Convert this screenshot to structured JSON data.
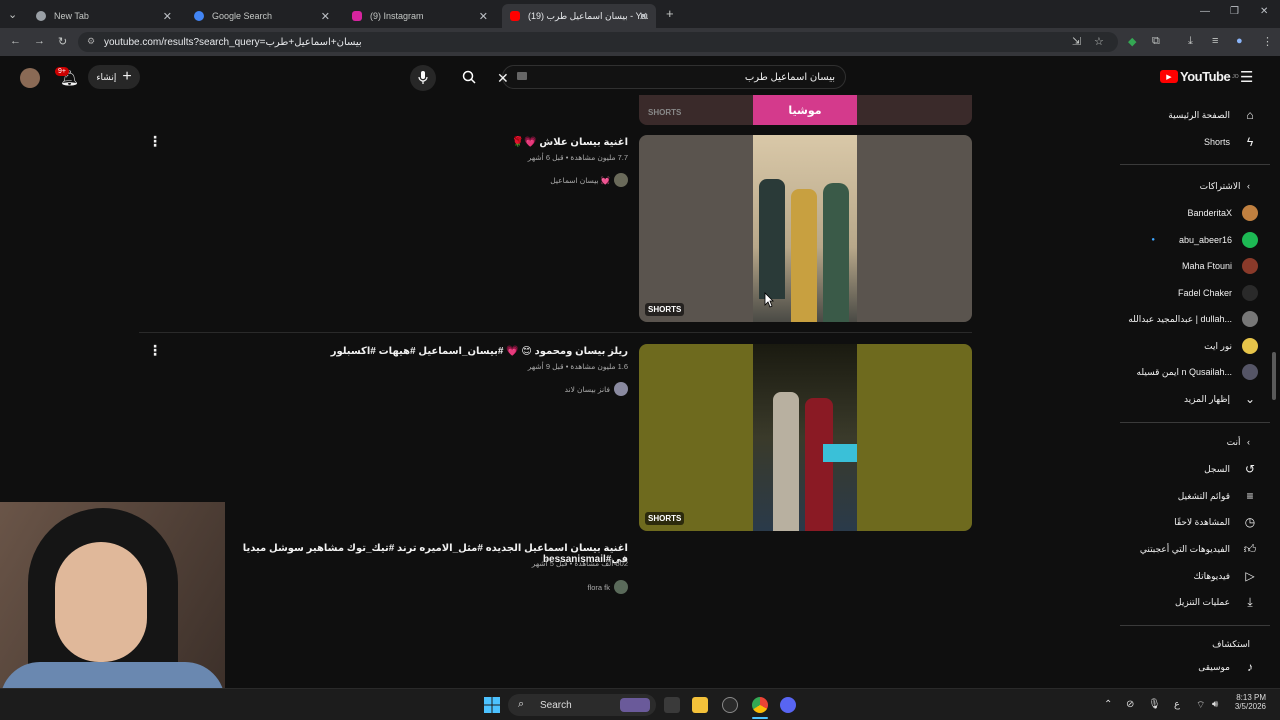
{
  "browser": {
    "tabs": [
      {
        "title": "New Tab",
        "active": false
      },
      {
        "title": "Google Search",
        "active": false
      },
      {
        "title": "(9) Instagram",
        "active": false
      },
      {
        "title": "(19) بيسان اسماعيل طرب - YouTube",
        "active": true
      }
    ],
    "url": "youtube.com/results?search_query=بيسان+اسماعيل+طرب"
  },
  "youtube": {
    "logo": "YouTube",
    "logo_country": "JO",
    "search_query": "بيسان اسماعيل طرب",
    "create_label": "إنشاء",
    "notif_count": "9+",
    "sidebar": {
      "home": "الصفحة الرئيسية",
      "shorts": "Shorts",
      "subscriptions_header": "الاشتراكات",
      "subscriptions": [
        {
          "name": "BanderitaX",
          "color": "#c08040"
        },
        {
          "name": "abu_abeer16",
          "color": "#1db954"
        },
        {
          "name": "Maha Ftouni",
          "color": "#8a3a2a"
        },
        {
          "name": "Fadel Chaker",
          "color": "#2a2a2a"
        },
        {
          "name": "عبدالمجيد عبدالله | dullah...",
          "color": "#777"
        },
        {
          "name": "نور ايت",
          "color": "#e6c44a"
        },
        {
          "name": "ايمن قسيله n Qusailah...",
          "color": "#556"
        }
      ],
      "show_more": "إظهار المزيد",
      "you_header": "أنت",
      "you_items": [
        {
          "label": "السجل",
          "icon": "history-icon"
        },
        {
          "label": "قوائم التشغيل",
          "icon": "playlist-icon"
        },
        {
          "label": "المشاهدة لاحقًا",
          "icon": "watch-later-icon"
        },
        {
          "label": "الفيديوهات التي أعجبتني",
          "icon": "like-icon"
        },
        {
          "label": "فيديوهاتك",
          "icon": "your-videos-icon"
        },
        {
          "label": "عمليات التنزيل",
          "icon": "download-icon"
        }
      ],
      "explore_header": "استكشاف",
      "music": "موسيقى"
    },
    "results": [
      {
        "title": "اغنية بيسان علاش 💗🌹",
        "meta": "7.7 مليون مشاهدة • قبل 6 أشهر",
        "channel": "بيسان اسماعيل 💓",
        "badge": "SHORTS"
      },
      {
        "title": "ريلز بيسان ومحمود 😊 💗 #بيسان_اسماعيل #هيهات #اكسبلور",
        "meta": "1.6 مليون مشاهدة • قبل 9 أشهر",
        "channel": "فانز بيسان لاند",
        "badge": "SHORTS"
      },
      {
        "title": "اغنية بيسان اسماعيل الجديده #مثل_الاميره ترند #تيك_توك مشاهير سوشل ميديا في#bessanismail",
        "meta": "502 ألف مشاهدة • قبل 5 أشهر",
        "channel": "flora fk",
        "badge": ""
      }
    ],
    "partial_badge": "SHORTS",
    "partial_text": "موشيا"
  },
  "taskbar": {
    "search": "Search",
    "time": "8:13 PM",
    "date": "3/5/2026",
    "lang": "ع"
  }
}
